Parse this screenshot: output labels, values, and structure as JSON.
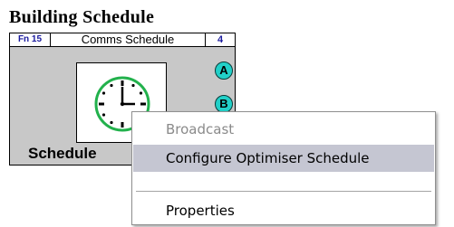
{
  "block": {
    "title": "Building Schedule",
    "function_label": "Fn 15",
    "schedule_name": "Comms Schedule",
    "block_number": "4",
    "caption": "Schedule",
    "icon": "clock-icon",
    "ports": [
      {
        "label": "A"
      },
      {
        "label": "B"
      }
    ],
    "colors": {
      "body": "#c8c8c8",
      "port": "#22d0c8",
      "label_accent": "#1a1a9e",
      "clock_face": "#22b14c"
    }
  },
  "context_menu": {
    "items": [
      {
        "label": "Broadcast",
        "enabled": false
      },
      {
        "label": "Configure Optimiser Schedule",
        "enabled": true,
        "highlighted": true
      },
      {
        "label": "Properties",
        "enabled": true
      }
    ],
    "highlight_color": "#c5c6d2"
  }
}
